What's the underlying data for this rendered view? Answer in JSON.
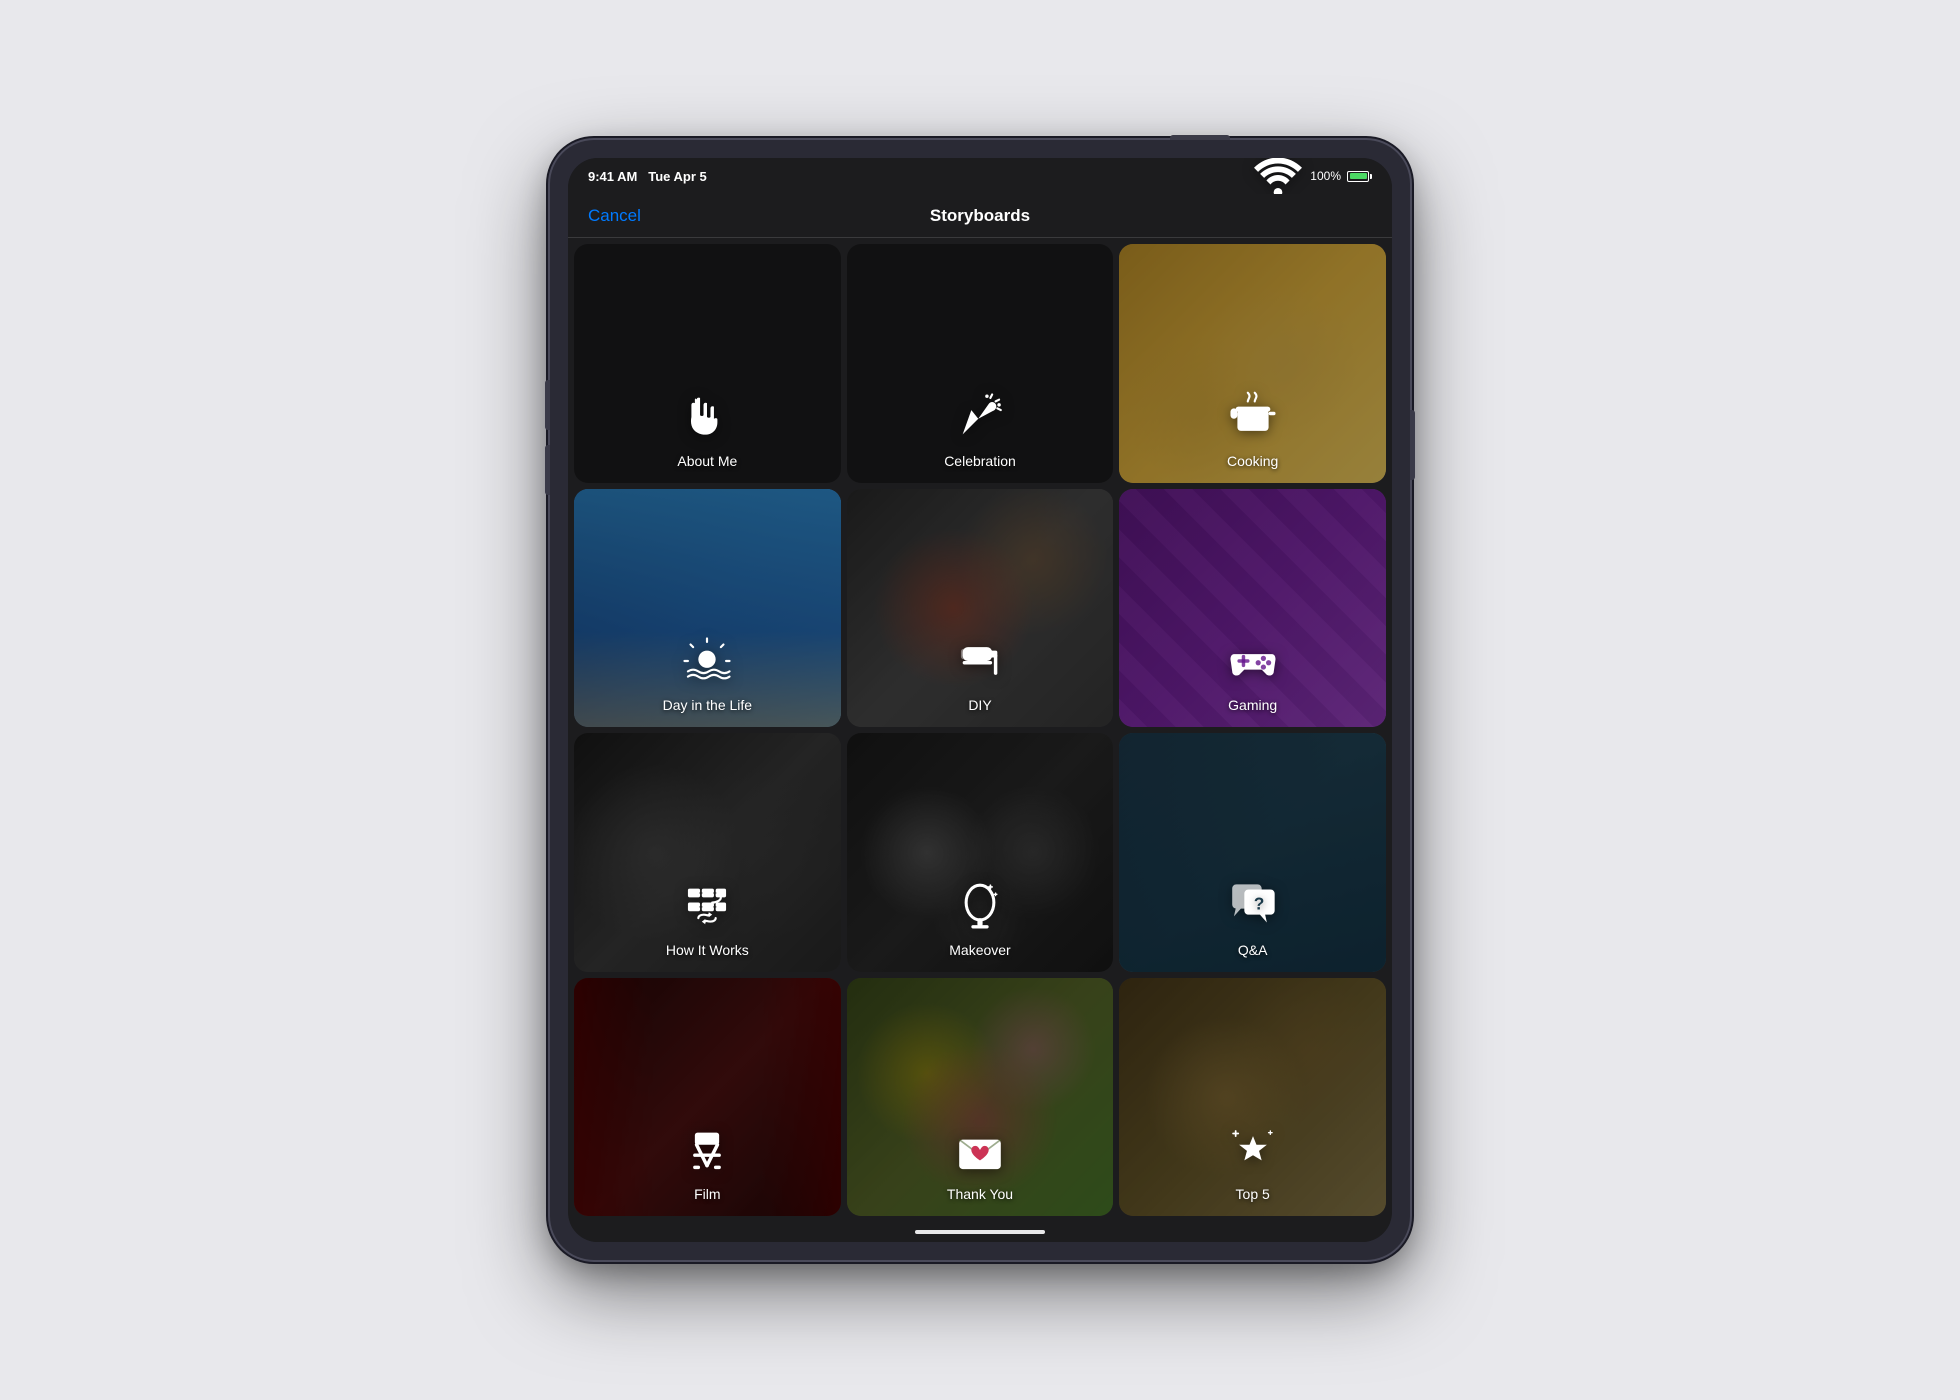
{
  "device": {
    "status_bar": {
      "time": "9:41 AM",
      "date": "Tue Apr 5",
      "battery_percent": "100%",
      "wifi": "WiFi"
    },
    "nav": {
      "cancel_label": "Cancel",
      "title": "Storyboards"
    }
  },
  "grid": {
    "items": [
      {
        "id": "about-me",
        "label": "About Me",
        "icon": "wave",
        "bg_class": "bg-about-me",
        "deco_class": "deco-leaves"
      },
      {
        "id": "celebration",
        "label": "Celebration",
        "icon": "party",
        "bg_class": "bg-celebration",
        "deco_class": "deco-balloons"
      },
      {
        "id": "cooking",
        "label": "Cooking",
        "icon": "pot",
        "bg_class": "bg-cooking",
        "deco_class": "deco-food"
      },
      {
        "id": "day-in-life",
        "label": "Day in the Life",
        "icon": "sunrise",
        "bg_class": "bg-day-in-life",
        "deco_class": "deco-sky"
      },
      {
        "id": "diy",
        "label": "DIY",
        "icon": "tools",
        "bg_class": "bg-diy",
        "deco_class": "deco-tools"
      },
      {
        "id": "gaming",
        "label": "Gaming",
        "icon": "gamepad",
        "bg_class": "bg-gaming",
        "deco_class": "deco-gaming-pattern"
      },
      {
        "id": "how-it-works",
        "label": "How It Works",
        "icon": "gears",
        "bg_class": "bg-how-it-works",
        "deco_class": "deco-gears"
      },
      {
        "id": "makeover",
        "label": "Makeover",
        "icon": "mirror",
        "bg_class": "bg-makeover",
        "deco_class": "deco-circles"
      },
      {
        "id": "qa",
        "label": "Q&A",
        "icon": "qa",
        "bg_class": "bg-qa",
        "deco_class": "deco-mics"
      },
      {
        "id": "film",
        "label": "Film",
        "icon": "film",
        "bg_class": "bg-film",
        "deco_class": "deco-curtains"
      },
      {
        "id": "thank-you",
        "label": "Thank You",
        "icon": "envelope",
        "bg_class": "bg-thank-you",
        "deco_class": "deco-flowers"
      },
      {
        "id": "top5",
        "label": "Top 5",
        "icon": "star",
        "bg_class": "bg-top5",
        "deco_class": "deco-stars"
      }
    ]
  }
}
